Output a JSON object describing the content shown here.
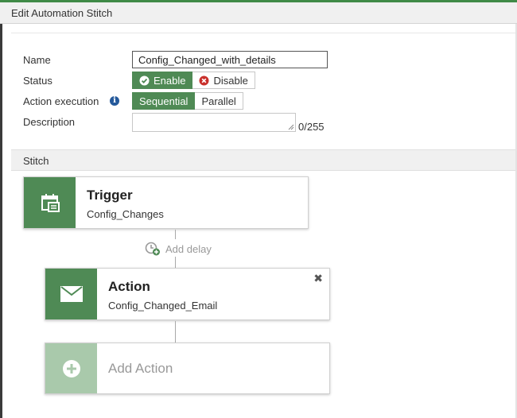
{
  "window": {
    "title": "Edit Automation Stitch"
  },
  "form": {
    "name_label": "Name",
    "name_value": "Config_Changed_with_details",
    "status_label": "Status",
    "status_enable": "Enable",
    "status_disable": "Disable",
    "status_selected": "Enable",
    "action_execution_label": "Action execution",
    "exec_sequential": "Sequential",
    "exec_parallel": "Parallel",
    "exec_selected": "Sequential",
    "description_label": "Description",
    "description_value": "",
    "description_count": "0/255"
  },
  "stitch": {
    "section_label": "Stitch",
    "trigger": {
      "title": "Trigger",
      "name": "Config_Changes",
      "icon": "calendar-icon"
    },
    "add_delay_label": "Add delay",
    "action": {
      "title": "Action",
      "name": "Config_Changed_Email",
      "icon": "envelope-icon"
    },
    "add_action_label": "Add Action"
  },
  "colors": {
    "accent_green": "#4f8a55",
    "accent_green_light": "#a9c9ab",
    "disable_red": "#c9302c",
    "info_blue": "#24599b"
  }
}
